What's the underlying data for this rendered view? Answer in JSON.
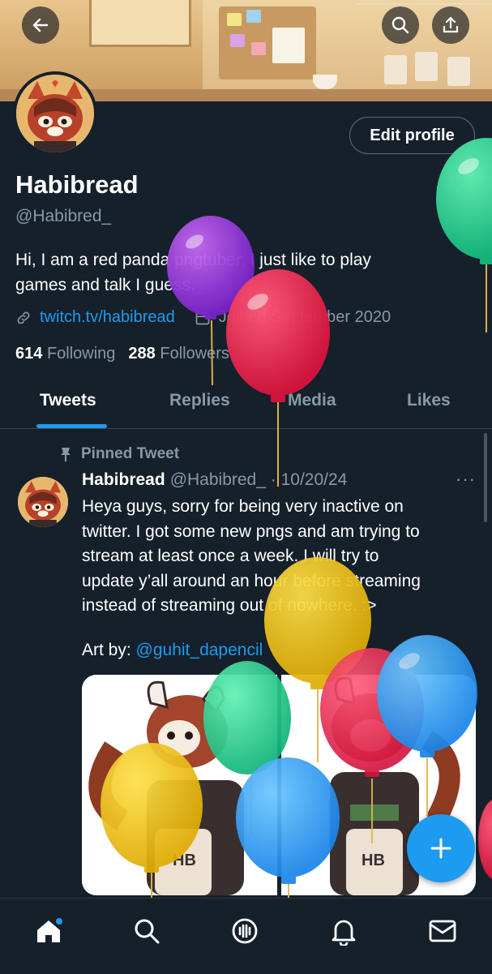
{
  "header": {
    "back_icon": "arrow-left-icon",
    "search_icon": "search-icon",
    "share_icon": "share-icon"
  },
  "profile": {
    "name": "Habibread",
    "handle": "@Habibred_",
    "edit_button": "Edit profile",
    "bio_line1": "Hi, I am a red panda pngtuber. I just like to play",
    "bio_line2": "games and talk I guess.",
    "link": "twitch.tv/habibread",
    "joined": "Joined September 2020",
    "following_count": "614",
    "following_label": "Following",
    "followers_count": "288",
    "followers_label": "Followers"
  },
  "tabs": [
    {
      "label": "Tweets",
      "active": true
    },
    {
      "label": "Replies",
      "active": false
    },
    {
      "label": "Media",
      "active": false
    },
    {
      "label": "Likes",
      "active": false
    }
  ],
  "tweet": {
    "pinned_label": "Pinned Tweet",
    "author": "Habibread",
    "handle_date": "@Habibred_ · 10/20/24",
    "more": "···",
    "lines": [
      "Heya guys, sorry for being very inactive on",
      "twitter. I got some new pngs and am trying to",
      "stream at least once a week. I will try to",
      "update y’all around an hour before streaming",
      "instead of streaming out of nowhere. :>"
    ],
    "art_by": "Art by: ",
    "art_mention": "@guhit_dapencil",
    "media_badge_left": "HB",
    "media_badge_right": "HB"
  },
  "fab": {
    "icon": "plus-icon"
  },
  "bottom_nav": [
    {
      "icon": "home-icon",
      "has_dot": true
    },
    {
      "icon": "search-icon"
    },
    {
      "icon": "spaces-icon"
    },
    {
      "icon": "bell-icon"
    },
    {
      "icon": "mail-icon"
    }
  ],
  "colors": {
    "background": "#15202b",
    "accent": "#1d9bf0",
    "secondary_text": "#8899a6"
  }
}
